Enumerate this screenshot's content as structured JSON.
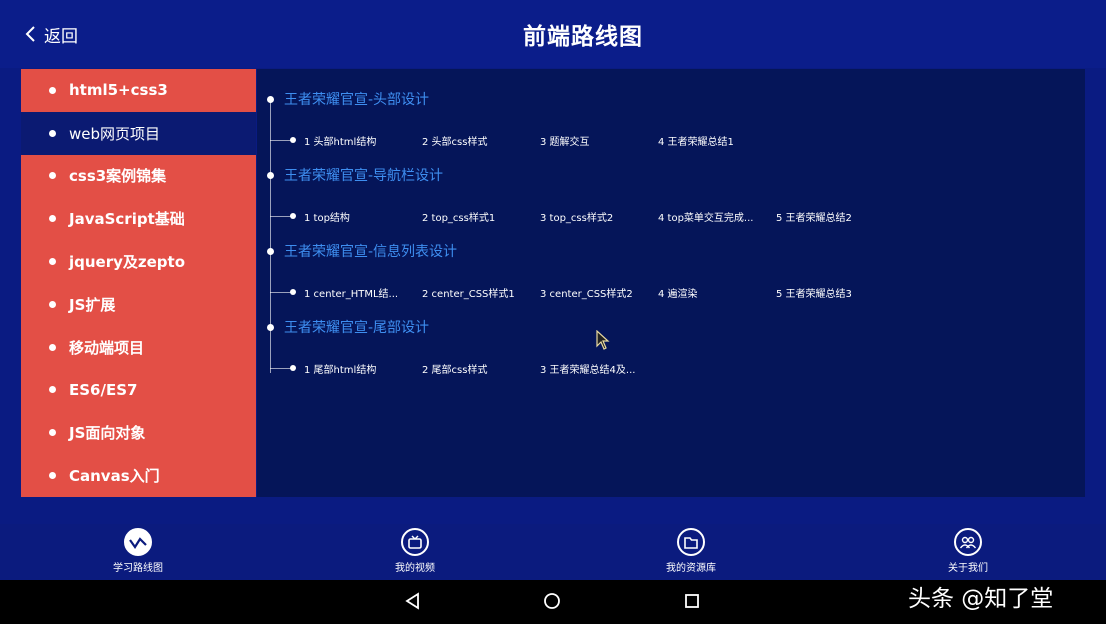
{
  "header": {
    "back_label": "返回",
    "title": "前端路线图"
  },
  "sidebar": {
    "items": [
      {
        "label": "html5+css3",
        "active": false
      },
      {
        "label": "web网页项目",
        "active": true
      },
      {
        "label": "css3案例锦集",
        "active": false
      },
      {
        "label": "JavaScript基础",
        "active": false
      },
      {
        "label": "jquery及zepto",
        "active": false
      },
      {
        "label": "JS扩展",
        "active": false
      },
      {
        "label": "移动端项目",
        "active": false
      },
      {
        "label": "ES6/ES7",
        "active": false
      },
      {
        "label": "JS面向对象",
        "active": false
      },
      {
        "label": "Canvas入门",
        "active": false
      }
    ]
  },
  "main": {
    "sections": [
      {
        "title": "王者荣耀官宣-头部设计",
        "items": [
          "1 头部html结构",
          "2 头部css样式",
          "3 题解交互",
          "4 王者荣耀总结1"
        ]
      },
      {
        "title": "王者荣耀官宣-导航栏设计",
        "items": [
          "1 top结构",
          "2 top_css样式1",
          "3 top_css样式2",
          "4 top菜单交互完成...",
          "5 王者荣耀总结2"
        ]
      },
      {
        "title": "王者荣耀官宣-信息列表设计",
        "items": [
          "1 center_HTML结...",
          "2 center_CSS样式1",
          "3 center_CSS样式2",
          "4 遍渲染",
          "5 王者荣耀总结3"
        ]
      },
      {
        "title": "王者荣耀官宣-尾部设计",
        "items": [
          "1 尾部html结构",
          "2 尾部css样式",
          "3 王者荣耀总结4及..."
        ]
      }
    ]
  },
  "tabbar": {
    "tabs": [
      {
        "label": "学习路线图",
        "icon": "route-icon"
      },
      {
        "label": "我的视频",
        "icon": "tv-icon"
      },
      {
        "label": "我的资源库",
        "icon": "folder-icon"
      },
      {
        "label": "关于我们",
        "icon": "people-icon"
      }
    ]
  },
  "watermark": "头条 @知了堂",
  "colors": {
    "background": "#0a1b82",
    "sidebar": "#e34f46",
    "sidebar_active": "#0b1a72",
    "panel": "#051559",
    "section_title": "#3e8ef0"
  }
}
